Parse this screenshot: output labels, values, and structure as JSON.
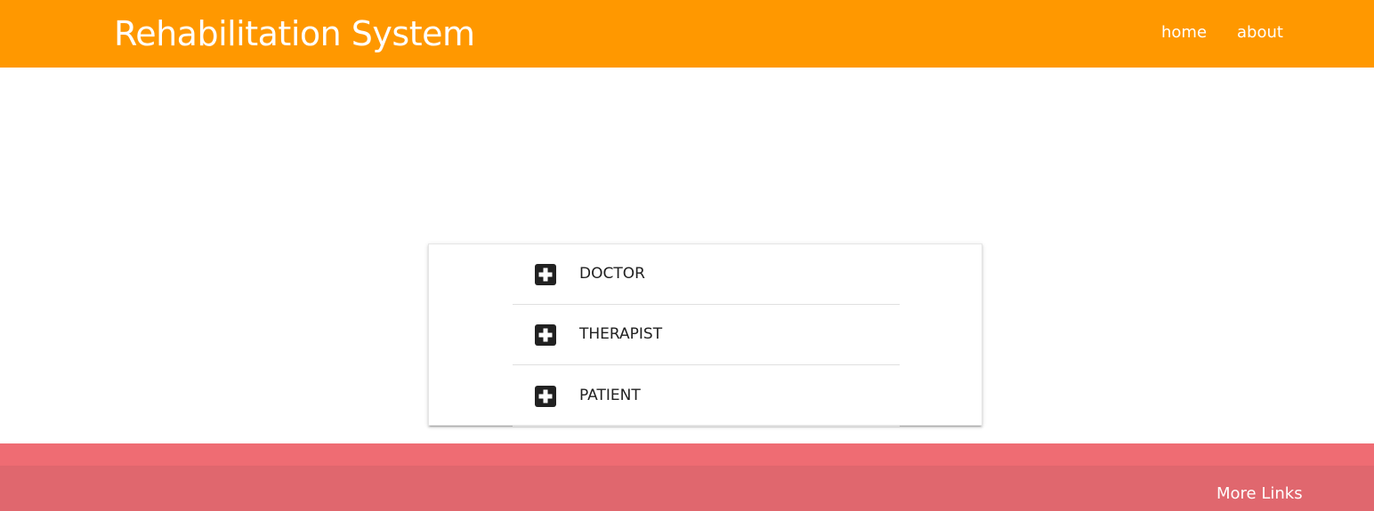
{
  "header": {
    "brand": "Rehabilitation System",
    "nav": [
      {
        "label": "home"
      },
      {
        "label": "about"
      }
    ],
    "color": "#ff9800"
  },
  "roles": {
    "icon": "medical-cross-icon",
    "items": [
      {
        "label": "DOCTOR"
      },
      {
        "label": "THERAPIST"
      },
      {
        "label": "PATIENT"
      }
    ]
  },
  "footer": {
    "link": "More Links",
    "color": "#ef6c73"
  }
}
